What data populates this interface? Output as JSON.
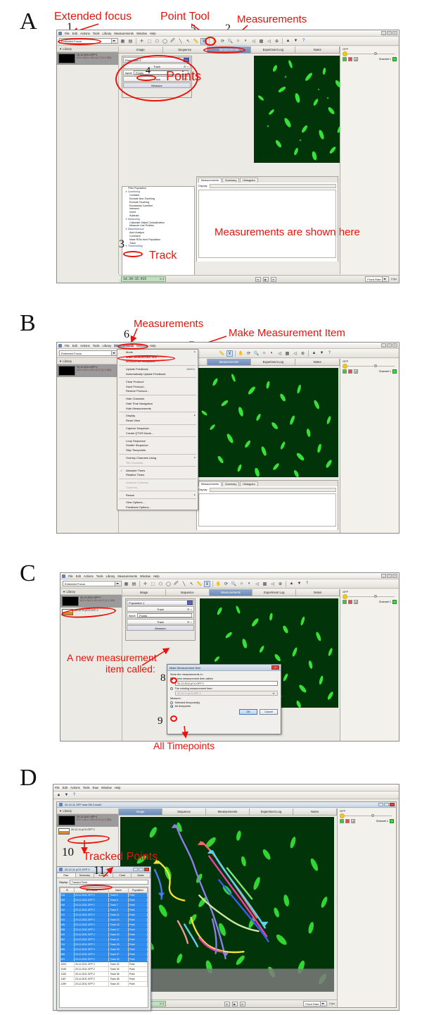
{
  "figure": {
    "panels": [
      "A",
      "B",
      "C",
      "D"
    ]
  },
  "app": {
    "menus": [
      "File",
      "Edit",
      "Actions",
      "Tools",
      "Library",
      "Measurements",
      "Window",
      "Help"
    ],
    "menus_d": [
      "File",
      "Edit",
      "Actions",
      "Tools",
      "Raw",
      "Window",
      "Help"
    ],
    "focus_combo": "Extended Focus",
    "tabs": [
      "Image",
      "Sequence",
      "Measurements",
      "Experiment Log",
      "Notes"
    ],
    "selected_tab": "Measurements",
    "library_header": "Library",
    "library_items": [
      {
        "line1": "20-12-2011 GFP 2",
        "line2": "672 x 512 x 28 x 6.17 (1.1 GB)"
      },
      {
        "line1": "20-12-11 pCX-GFP 2",
        "line2": ""
      }
    ],
    "window_title_d": "20-12-11 GFP near OB 2.mvd2"
  },
  "protocol": {
    "population": "Population 1",
    "rows": [
      "Track",
      "Track"
    ],
    "input_label": "Input:",
    "input_value": "Points",
    "measure_button": "Measure"
  },
  "operations": {
    "top_item": "Filter Population",
    "groups": [
      {
        "name": "Combining",
        "items": [
          "Combine",
          "Exclude Non-Touching",
          "Exclude Touching",
          "Exclusively Combine",
          "Intersect",
          "Invert",
          "Subtract"
        ]
      },
      {
        "name": "Measuring",
        "items": [
          "Calculate Object Colocalization",
          "Measure Line Profiles"
        ]
      },
      {
        "name": "Miscellaneous",
        "items": [
          "Auto Analyze",
          "Comment",
          "Make ROIs from Population",
          "Track"
        ]
      },
      {
        "name": "Thresholding",
        "items": []
      }
    ]
  },
  "measurements_pane": {
    "tabs": [
      "Measurements",
      "Summary",
      "Histogram"
    ],
    "selected_tab": "Measurements",
    "display_label": "Display:",
    "display_value": ""
  },
  "statusbar": {
    "timestamp": "14:39:15.915",
    "ratio": "1:1",
    "prev": "≪",
    "play": "▶",
    "next": "≫",
    "rate_label": "Fixed Rate",
    "rate_value": "0 fps"
  },
  "channel_panel": {
    "title": "GFP",
    "channel_label": "Channel 1",
    "channel_color": "#2fe02f"
  },
  "measurements_menu": {
    "title": "Measurements",
    "items": [
      {
        "label": "Mode",
        "type": "submenu"
      },
      {
        "label": "Make Measurement Item...",
        "type": "item",
        "highlight": true
      },
      {
        "label": "Measure All Timepoints",
        "type": "item"
      },
      {
        "type": "sep"
      },
      {
        "label": "Update Feedback",
        "type": "item",
        "accel": "Ctrl+U"
      },
      {
        "label": "Automatically Update Feedback",
        "type": "item"
      },
      {
        "type": "sep"
      },
      {
        "label": "Clear Protocol",
        "type": "item"
      },
      {
        "label": "Save Protocol...",
        "type": "item"
      },
      {
        "label": "Restore Protocol...",
        "type": "item"
      },
      {
        "type": "sep"
      },
      {
        "label": "Hide Channels",
        "type": "item"
      },
      {
        "label": "Hide Time Navigation",
        "type": "item"
      },
      {
        "label": "Hide Measurements",
        "type": "item"
      },
      {
        "type": "sep"
      },
      {
        "label": "Display",
        "type": "submenu"
      },
      {
        "label": "Reset View",
        "type": "item"
      },
      {
        "type": "sep"
      },
      {
        "label": "Capture Snapshot...",
        "type": "item"
      },
      {
        "label": "Create QTVR Movie...",
        "type": "item"
      },
      {
        "type": "sep"
      },
      {
        "label": "Loop Sequence",
        "type": "item"
      },
      {
        "label": "Shuttle Sequence",
        "type": "item"
      },
      {
        "label": "Skip Timepoints",
        "type": "item"
      },
      {
        "type": "sep"
      },
      {
        "label": "Overlay Channels Using",
        "type": "submenu"
      },
      {
        "label": "Tile Channels",
        "type": "item",
        "disabled": true
      },
      {
        "type": "sep"
      },
      {
        "label": "Absolute Times",
        "type": "item",
        "checked": true
      },
      {
        "label": "Relative Times",
        "type": "item"
      },
      {
        "type": "sep"
      },
      {
        "label": "Autosize Columns",
        "type": "item",
        "disabled": true
      },
      {
        "label": "Columns...",
        "type": "item",
        "disabled": true
      },
      {
        "type": "sep"
      },
      {
        "label": "Resize",
        "type": "submenu"
      },
      {
        "type": "sep"
      },
      {
        "label": "View Options...",
        "type": "item"
      },
      {
        "label": "Feedback Options...",
        "type": "item"
      }
    ]
  },
  "dialog": {
    "title": "Make Measurement Item",
    "store_label": "Store the measurements in:",
    "new_item_label": "A new measurement item called:",
    "new_item_value": "20-12-2011 pCX-GFP 2",
    "existing_item_label": "The existing measurement item:",
    "existing_item_value": "20-12-11 pCX-GFP 2",
    "measure_label": "Measure:",
    "selected_timepoints_label": "Selected timepoint(s)",
    "all_timepoints_label": "All timepoints",
    "ok": "OK",
    "cancel": "Cancel"
  },
  "data_window": {
    "title": "20-12-11 pCX-GFP 2",
    "tabs": [
      "Raw",
      "Summary",
      "Analysis",
      "Chart",
      "Notes"
    ],
    "selected_tab": "Raw",
    "display_label": "Display:",
    "display_value": "Tracked Point",
    "columns": [
      "ID",
      "Item Name",
      "Name",
      "Population"
    ],
    "rows": [
      {
        "id": "124",
        "item": "20-12-2011 GFP 2",
        "name": "Track 5",
        "pop": "Point",
        "selected": true
      },
      {
        "id": "186",
        "item": "20-12-2011 GFP 2",
        "name": "Track 6",
        "pop": "Point",
        "selected": true
      },
      {
        "id": "248",
        "item": "20-12-2011 GFP 2",
        "name": "Track 7",
        "pop": "Point",
        "selected": true
      },
      {
        "id": "310",
        "item": "20-12-2011 GFP 2",
        "name": "Track 9",
        "pop": "Point",
        "selected": true
      },
      {
        "id": "372",
        "item": "20-12-2011 GFP 2",
        "name": "Track 11",
        "pop": "Point",
        "selected": true
      },
      {
        "id": "434",
        "item": "20-12-2011 GFP 2",
        "name": "Track 13",
        "pop": "Point",
        "selected": true
      },
      {
        "id": "496",
        "item": "20-12-2011 GFP 2",
        "name": "Track 15",
        "pop": "Point",
        "selected": true
      },
      {
        "id": "558",
        "item": "20-12-2011 GFP 2",
        "name": "Track 17",
        "pop": "Point",
        "selected": true
      },
      {
        "id": "620",
        "item": "20-12-2011 GFP 2",
        "name": "Track 19",
        "pop": "Point",
        "selected": true
      },
      {
        "id": "682",
        "item": "20-12-2011 GFP 2",
        "name": "Track 21",
        "pop": "Point",
        "selected": true
      },
      {
        "id": "744",
        "item": "20-12-2011 GFP 2",
        "name": "Track 23",
        "pop": "Point",
        "selected": true
      },
      {
        "id": "806",
        "item": "20-12-2011 GFP 2",
        "name": "Track 25",
        "pop": "Point",
        "selected": true
      },
      {
        "id": "868",
        "item": "20-12-2011 GFP 2",
        "name": "Track 27",
        "pop": "Point",
        "selected": true
      },
      {
        "id": "931",
        "item": "20-12-2011 GFP 2",
        "name": "Track 30",
        "pop": "Point",
        "selected": true
      },
      {
        "id": "1004",
        "item": "20-12-2011 GFP 2",
        "name": "Track 32",
        "pop": "Point",
        "selected": false
      },
      {
        "id": "1045",
        "item": "20-12-2011 GFP 2",
        "name": "Track 34",
        "pop": "Point",
        "selected": false
      },
      {
        "id": "1105",
        "item": "20-12-2011 GFP 2",
        "name": "Track 36",
        "pop": "Point",
        "selected": false
      },
      {
        "id": "1167",
        "item": "20-12-2011 GFP 2",
        "name": "Track 38",
        "pop": "Point",
        "selected": false
      },
      {
        "id": "1199",
        "item": "20-12-2011 GFP 2",
        "name": "Track 40",
        "pop": "Point",
        "selected": false
      }
    ]
  },
  "annotations": {
    "a": {
      "extended_focus": "Extended focus",
      "point_tool": "Point Tool",
      "measurements": "Measurements",
      "points": "Points",
      "track": "Track",
      "measurements_shown": "Measurements are shown here",
      "n1": "1",
      "n2": "2",
      "n3": "3",
      "n4": "4",
      "n5": "5"
    },
    "b": {
      "measurements": "Measurements",
      "make_measurement_item": "Make Measurement Item",
      "n6": "6",
      "n7": "7"
    },
    "c": {
      "new_item_line1": "A new measurement",
      "new_item_line2": "item called:",
      "all_timepoints": "All Timepoints",
      "n8": "8",
      "n9": "9"
    },
    "d": {
      "tracked_points": "Tracked Points",
      "n10": "10",
      "n11": "11"
    }
  }
}
